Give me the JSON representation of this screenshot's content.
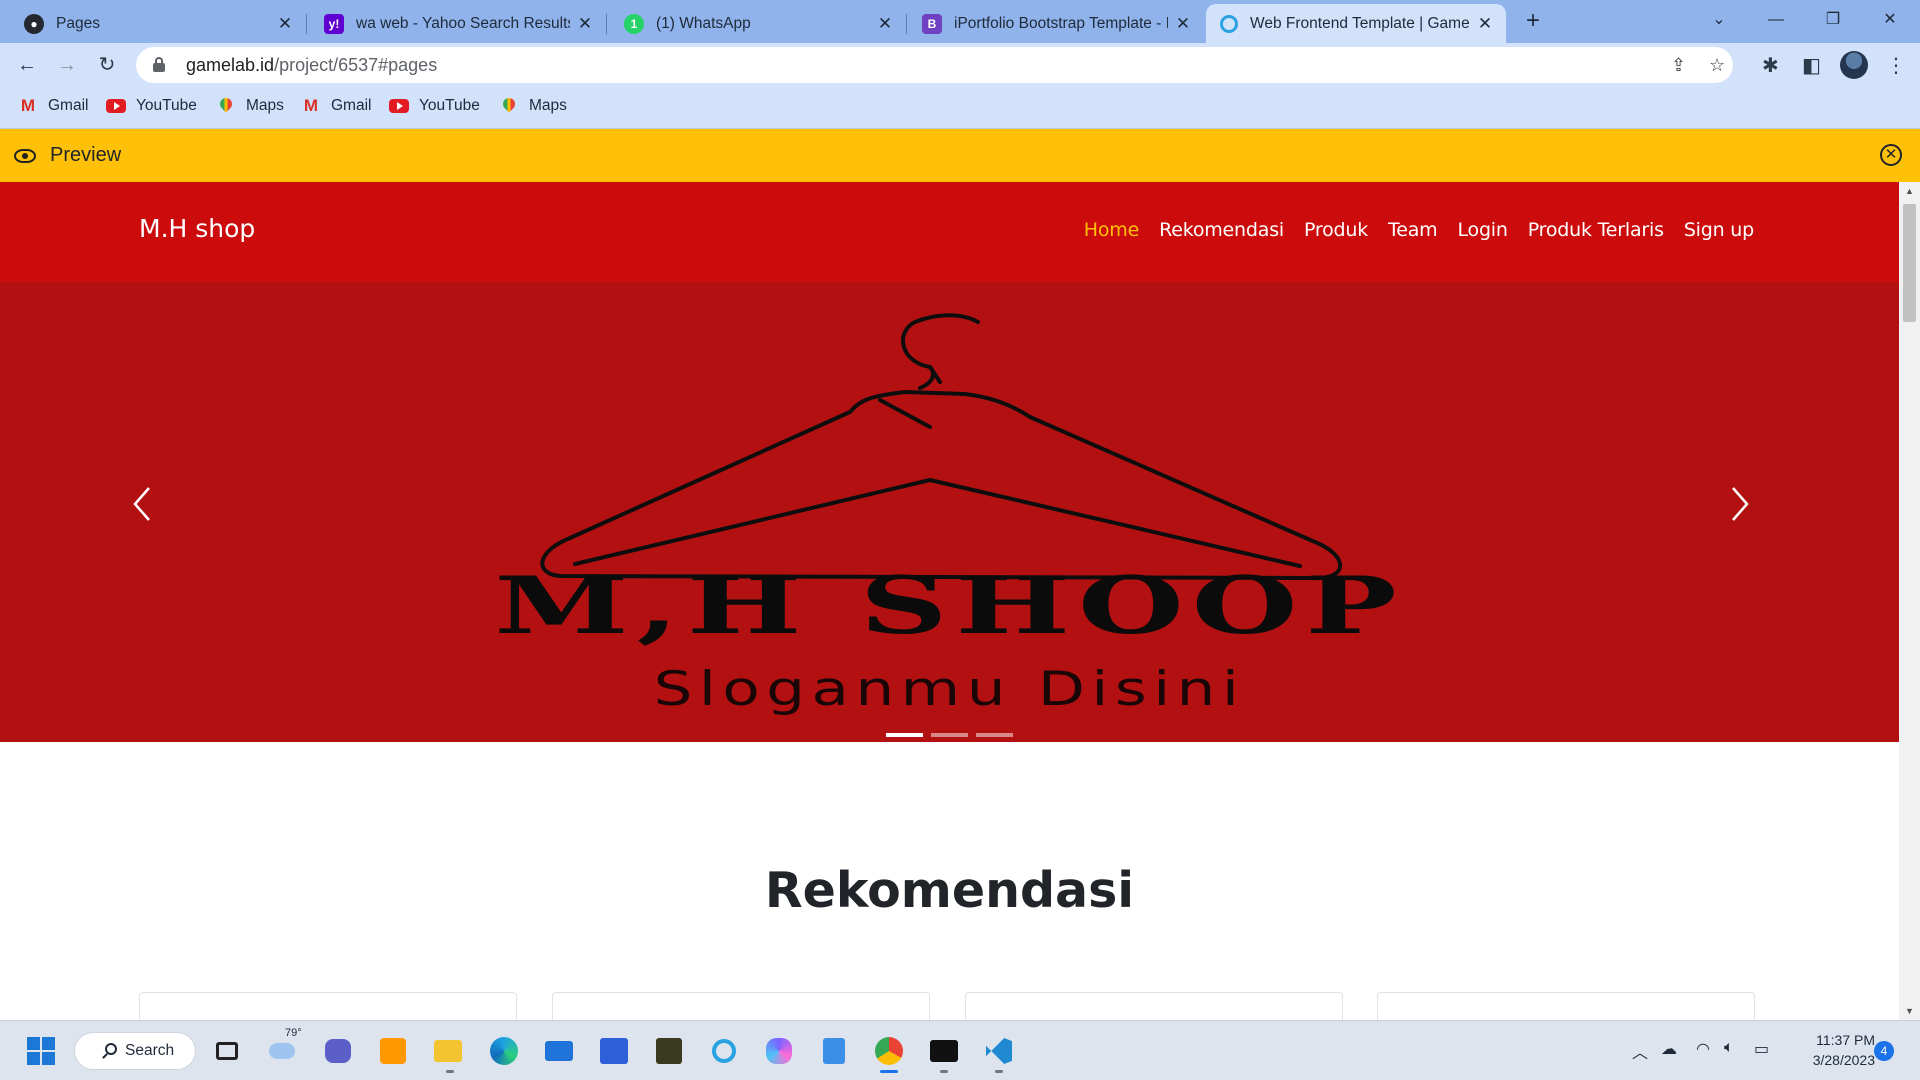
{
  "browser": {
    "tabs": [
      {
        "title": "Pages",
        "icon": "github-icon"
      },
      {
        "title": "wa web - Yahoo Search Results",
        "icon": "yahoo-icon"
      },
      {
        "title": "(1) WhatsApp",
        "icon": "whatsapp-icon"
      },
      {
        "title": "iPortfolio Bootstrap Template - In",
        "icon": "bootstrap-icon"
      },
      {
        "title": "Web Frontend Template | Gamela",
        "icon": "gamelab-icon",
        "active": true
      }
    ],
    "url_host": "gamelab.id",
    "url_path": "/project/6537#pages",
    "bookmarks": [
      {
        "label": "Gmail",
        "icon": "gmail-icon"
      },
      {
        "label": "YouTube",
        "icon": "youtube-icon"
      },
      {
        "label": "Maps",
        "icon": "maps-icon"
      },
      {
        "label": "Gmail",
        "icon": "gmail-icon"
      },
      {
        "label": "YouTube",
        "icon": "youtube-icon"
      },
      {
        "label": "Maps",
        "icon": "maps-icon"
      }
    ]
  },
  "preview": {
    "label": "Preview"
  },
  "site": {
    "brand": "M.H shop",
    "menu": [
      {
        "label": "Home",
        "active": true
      },
      {
        "label": "Rekomendasi"
      },
      {
        "label": "Produk"
      },
      {
        "label": "Team"
      },
      {
        "label": "Login"
      },
      {
        "label": "Produk Terlaris"
      },
      {
        "label": "Sign up"
      }
    ],
    "hero": {
      "title": "M,H SHOOP",
      "slogan": "Sloganmu Disini",
      "slides": 3,
      "active_slide": 1
    },
    "section_title": "Rekomendasi",
    "card_count": 4
  },
  "taskbar": {
    "search_label": "Search",
    "weather_temp": "79°",
    "time": "11:37 PM",
    "date": "3/28/2023",
    "notifications": "4"
  },
  "colors": {
    "tab_bar": "#8fb3ea",
    "toolbar": "#d3e2fb",
    "preview_bar": "#ffc107",
    "site_nav": "#cc0c0c",
    "hero_bg": "#b31111",
    "active_link": "#ffc107"
  }
}
